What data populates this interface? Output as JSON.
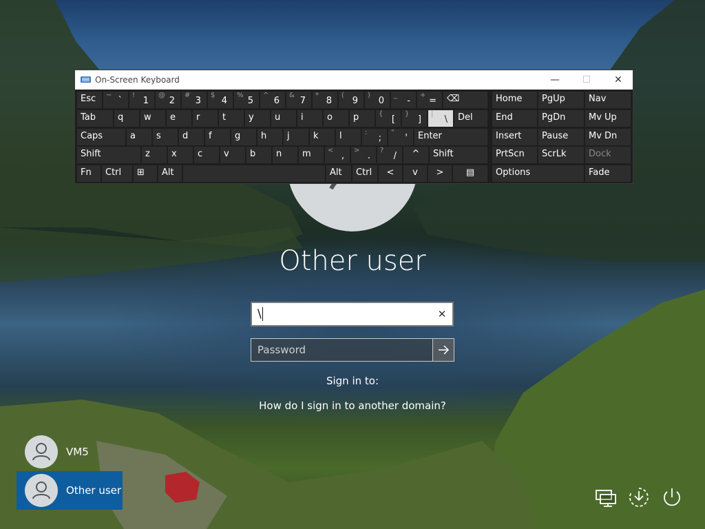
{
  "osk": {
    "title": "On-Screen Keyboard",
    "window_buttons": {
      "minimize": "—",
      "maximize": "☐",
      "close": "✕"
    },
    "rows": [
      {
        "keys": [
          {
            "main": "Esc"
          },
          {
            "sub": "~",
            "main": "`"
          },
          {
            "sub": "!",
            "main": "1"
          },
          {
            "sub": "@",
            "main": "2"
          },
          {
            "sub": "#",
            "main": "3"
          },
          {
            "sub": "$",
            "main": "4"
          },
          {
            "sub": "%",
            "main": "5"
          },
          {
            "sub": "^",
            "main": "6"
          },
          {
            "sub": "&",
            "main": "7"
          },
          {
            "sub": "*",
            "main": "8"
          },
          {
            "sub": "(",
            "main": "9"
          },
          {
            "sub": ")",
            "main": "0"
          },
          {
            "sub": "_",
            "main": "-"
          },
          {
            "sub": "+",
            "main": "="
          },
          {
            "main": "⌫"
          }
        ]
      },
      {
        "keys": [
          {
            "main": "Tab"
          },
          {
            "main": "q"
          },
          {
            "main": "w"
          },
          {
            "main": "e"
          },
          {
            "main": "r"
          },
          {
            "main": "t"
          },
          {
            "main": "y"
          },
          {
            "main": "u"
          },
          {
            "main": "i"
          },
          {
            "main": "o"
          },
          {
            "main": "p"
          },
          {
            "sub": "{",
            "main": "["
          },
          {
            "sub": "}",
            "main": "]"
          },
          {
            "sub": "|",
            "main": "\\"
          },
          {
            "main": "Del"
          }
        ]
      },
      {
        "keys": [
          {
            "main": "Caps"
          },
          {
            "main": "a"
          },
          {
            "main": "s"
          },
          {
            "main": "d"
          },
          {
            "main": "f"
          },
          {
            "main": "g"
          },
          {
            "main": "h"
          },
          {
            "main": "j"
          },
          {
            "main": "k"
          },
          {
            "main": "l"
          },
          {
            "sub": ":",
            "main": ";"
          },
          {
            "sub": "\"",
            "main": "'"
          },
          {
            "main": "Enter"
          }
        ]
      },
      {
        "keys": [
          {
            "main": "Shift"
          },
          {
            "main": "z"
          },
          {
            "main": "x"
          },
          {
            "main": "c"
          },
          {
            "main": "v"
          },
          {
            "main": "b"
          },
          {
            "main": "n"
          },
          {
            "main": "m"
          },
          {
            "sub": "<",
            "main": ","
          },
          {
            "sub": ">",
            "main": "."
          },
          {
            "sub": "?",
            "main": "/"
          },
          {
            "main": "^"
          },
          {
            "main": "Shift"
          }
        ]
      },
      {
        "keys": [
          {
            "main": "Fn"
          },
          {
            "main": "Ctrl"
          },
          {
            "main": "⊞"
          },
          {
            "main": "Alt"
          },
          {
            "main": ""
          },
          {
            "main": "Alt"
          },
          {
            "main": "Ctrl"
          },
          {
            "main": "<"
          },
          {
            "main": "v"
          },
          {
            "main": ">"
          },
          {
            "main": "▤"
          }
        ]
      }
    ],
    "nav_keys": [
      [
        "Home",
        "PgUp",
        "Nav"
      ],
      [
        "End",
        "PgDn",
        "Mv Up"
      ],
      [
        "Insert",
        "Pause",
        "Mv Dn"
      ],
      [
        "PrtScn",
        "ScrLk",
        "Dock"
      ],
      [
        "Options",
        "Fade"
      ]
    ]
  },
  "login": {
    "title": "Other user",
    "username_value": "\\",
    "clear_glyph": "✕",
    "password_placeholder": "Password",
    "sign_in_to": "Sign in to:",
    "domain_link": "How do I sign in to another domain?"
  },
  "users": [
    {
      "name": "VM5",
      "selected": false
    },
    {
      "name": "Other user",
      "selected": true
    }
  ],
  "system_icons": [
    "network-icon",
    "ease-of-access-icon",
    "power-icon"
  ],
  "colors": {
    "accent": "#0e5d9e",
    "highlight_key": "#dcdcdc"
  }
}
